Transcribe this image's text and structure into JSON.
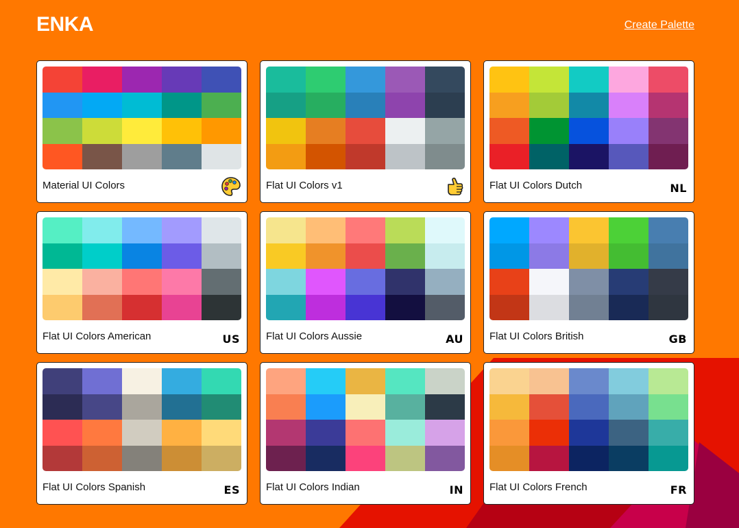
{
  "header": {
    "logo": "ENKA",
    "create_link": "Create Palette"
  },
  "palettes": [
    {
      "name": "Material UI Colors",
      "tag": "",
      "emoji": "palette-icon",
      "colors": [
        "#f44336",
        "#e91e63",
        "#9c27b0",
        "#673ab7",
        "#3f51b5",
        "#2196f3",
        "#03a9f4",
        "#00bcd4",
        "#009688",
        "#4caf50",
        "#8bc34a",
        "#cddc39",
        "#ffeb3b",
        "#ffc107",
        "#ff9800",
        "#ff5722",
        "#795548",
        "#9e9e9e",
        "#607d8b",
        "#dfe4e6"
      ]
    },
    {
      "name": "Flat UI Colors v1",
      "tag": "",
      "emoji": "hand-icon",
      "colors": [
        "#1abc9c",
        "#2ecc71",
        "#3498db",
        "#9b59b6",
        "#34495e",
        "#16a085",
        "#27ae60",
        "#2980b9",
        "#8e44ad",
        "#2c3e50",
        "#f1c40f",
        "#e67e22",
        "#e74c3c",
        "#ecf0f1",
        "#95a5a6",
        "#f39c12",
        "#d35400",
        "#c0392b",
        "#bdc3c7",
        "#7f8c8d"
      ]
    },
    {
      "name": "Flat UI Colors Dutch",
      "tag": "NL",
      "emoji": "",
      "colors": [
        "#ffc312",
        "#c4e538",
        "#12cbc4",
        "#fda7df",
        "#ed4c67",
        "#f79f1f",
        "#a3cb38",
        "#1289a7",
        "#d980fa",
        "#b53471",
        "#ee5a24",
        "#009432",
        "#0652dd",
        "#9980fa",
        "#833471",
        "#ea2027",
        "#006266",
        "#1b1464",
        "#5758bb",
        "#6f1e51"
      ]
    },
    {
      "name": "Flat UI Colors American",
      "tag": "US",
      "emoji": "",
      "colors": [
        "#55efc4",
        "#81ecec",
        "#74b9ff",
        "#a29bfe",
        "#dfe6e9",
        "#00b894",
        "#00cec9",
        "#0984e3",
        "#6c5ce7",
        "#b2bec3",
        "#ffeaa7",
        "#fab1a0",
        "#ff7675",
        "#fd79a8",
        "#636e72",
        "#fdcb6e",
        "#e17055",
        "#d63031",
        "#e84393",
        "#2d3436"
      ]
    },
    {
      "name": "Flat UI Colors Aussie",
      "tag": "AU",
      "emoji": "",
      "colors": [
        "#f6e58d",
        "#ffbe76",
        "#ff7979",
        "#badc58",
        "#dff9fb",
        "#f9ca24",
        "#f0932b",
        "#eb4d4b",
        "#6ab04c",
        "#c7ecee",
        "#7ed6df",
        "#e056fd",
        "#686de0",
        "#30336b",
        "#95afc0",
        "#22a6b3",
        "#be2edd",
        "#4834d4",
        "#130f40",
        "#535c68"
      ]
    },
    {
      "name": "Flat UI Colors British",
      "tag": "GB",
      "emoji": "",
      "colors": [
        "#00a8ff",
        "#9c88ff",
        "#fbc531",
        "#4cd137",
        "#487eb0",
        "#0097e6",
        "#8c7ae6",
        "#e1b12c",
        "#44bd32",
        "#40739e",
        "#e84118",
        "#f5f6fa",
        "#7f8fa6",
        "#273c75",
        "#353b48",
        "#c23616",
        "#dcdde1",
        "#718093",
        "#192a56",
        "#2f3640"
      ]
    },
    {
      "name": "Flat UI Colors Spanish",
      "tag": "ES",
      "emoji": "",
      "colors": [
        "#40407a",
        "#706fd3",
        "#f7f1e3",
        "#34ace0",
        "#33d9b2",
        "#2c2c54",
        "#474787",
        "#aaa69d",
        "#227093",
        "#218c74",
        "#ff5252",
        "#ff793f",
        "#d1ccc0",
        "#ffb142",
        "#ffda79",
        "#b33939",
        "#cd6133",
        "#84817a",
        "#cc8e35",
        "#ccae62"
      ]
    },
    {
      "name": "Flat UI Colors Indian",
      "tag": "IN",
      "emoji": "",
      "colors": [
        "#fea47f",
        "#25ccf7",
        "#eab543",
        "#55e6c1",
        "#cad3c8",
        "#f97f51",
        "#1b9cfc",
        "#f8efba",
        "#58b19f",
        "#2c3a47",
        "#b33771",
        "#3b3b98",
        "#fd7272",
        "#9aecdb",
        "#d6a2e8",
        "#6d214f",
        "#182c61",
        "#fc427b",
        "#bdc581",
        "#82589f"
      ]
    },
    {
      "name": "Flat UI Colors French",
      "tag": "FR",
      "emoji": "",
      "colors": [
        "#fad390",
        "#f8c291",
        "#6a89cc",
        "#82ccdd",
        "#b8e994",
        "#f6b93b",
        "#e55039",
        "#4a69bd",
        "#60a3bc",
        "#78e08f",
        "#fa983a",
        "#eb2f06",
        "#1e3799",
        "#3c6382",
        "#38ada9",
        "#e58e26",
        "#b71540",
        "#0c2461",
        "#0a3d62",
        "#079992"
      ]
    }
  ]
}
